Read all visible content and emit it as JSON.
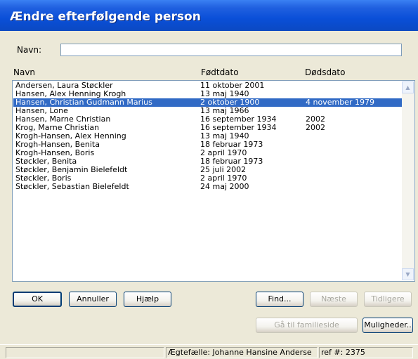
{
  "window": {
    "title": "Ændre efterfølgende person"
  },
  "search": {
    "label": "Navn:",
    "value": ""
  },
  "columns": {
    "name": "Navn",
    "born": "Fødtdato",
    "died": "Dødsdato"
  },
  "rows": [
    {
      "name": "Andersen, Laura Støckler",
      "born": "11 oktober 2001",
      "died": ""
    },
    {
      "name": "Hansen, Alex Henning Krogh",
      "born": "13 maj 1940",
      "died": ""
    },
    {
      "name": "Hansen, Christian Gudmann Marius",
      "born": "2 oktober 1900",
      "died": "4 november 1979"
    },
    {
      "name": "Hansen, Lone",
      "born": "13 maj 1966",
      "died": ""
    },
    {
      "name": "Hansen, Marne Christian",
      "born": "16 september 1934",
      "died": "2002"
    },
    {
      "name": "Krog, Marne Christian",
      "born": "16 september 1934",
      "died": "2002"
    },
    {
      "name": "Krogh-Hansen, Alex Henning",
      "born": "13 maj 1940",
      "died": ""
    },
    {
      "name": "Krogh-Hansen, Benita",
      "born": "18 februar 1973",
      "died": ""
    },
    {
      "name": "Krogh-Hansen, Boris",
      "born": "2 april 1970",
      "died": ""
    },
    {
      "name": "Støckler, Benita",
      "born": "18 februar 1973",
      "died": ""
    },
    {
      "name": "Støckler, Benjamin Bielefeldt",
      "born": "25 juli 2002",
      "died": ""
    },
    {
      "name": "Støckler, Boris",
      "born": "2 april 1970",
      "died": ""
    },
    {
      "name": "Støckler, Sebastian Bielefeldt",
      "born": "24 maj 2000",
      "died": ""
    }
  ],
  "selected_index": 2,
  "buttons": {
    "ok": "OK",
    "cancel": "Annuller",
    "help": "Hjælp",
    "find": "Find...",
    "next": "Næste",
    "previous": "Tidligere",
    "family_page": "Gå til familieside",
    "options": "Muligheder.."
  },
  "status": {
    "left": "",
    "spouse": "Ægtefælle: Johanne Hansine Anderse",
    "ref": "ref #: 2375"
  },
  "colors": {
    "selection": "#316ac5",
    "title_bar": "#0a4fd8",
    "face": "#ece9d8"
  }
}
